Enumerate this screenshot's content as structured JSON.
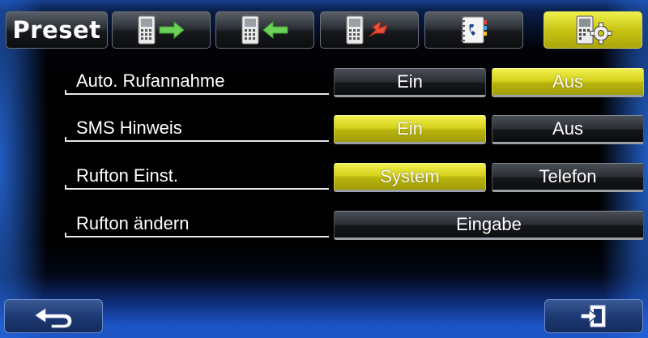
{
  "header": {
    "preset_label": "Preset",
    "tabs": [
      {
        "name": "tab-preset",
        "icon": "text",
        "active": false
      },
      {
        "name": "tab-outgoing-calls",
        "icon": "phone-arrow-out-icon",
        "active": false
      },
      {
        "name": "tab-incoming-calls",
        "icon": "phone-arrow-in-icon",
        "active": false
      },
      {
        "name": "tab-missed-calls",
        "icon": "phone-missed-icon",
        "active": false
      },
      {
        "name": "tab-phonebook",
        "icon": "phonebook-icon",
        "active": false
      },
      {
        "name": "tab-phone-settings",
        "icon": "phone-gear-icon",
        "active": true
      }
    ]
  },
  "settings": {
    "rows": [
      {
        "label": "Auto. Rufannahme",
        "options": [
          {
            "label": "Ein",
            "selected": false
          },
          {
            "label": "Aus",
            "selected": true
          }
        ]
      },
      {
        "label": "SMS Hinweis",
        "options": [
          {
            "label": "Ein",
            "selected": true
          },
          {
            "label": "Aus",
            "selected": false
          }
        ]
      },
      {
        "label": "Rufton Einst.",
        "options": [
          {
            "label": "System",
            "selected": true
          },
          {
            "label": "Telefon",
            "selected": false
          }
        ]
      },
      {
        "label": "Rufton ändern",
        "options": [
          {
            "label": "Eingabe",
            "selected": false
          }
        ]
      }
    ]
  },
  "footer": {
    "back_icon": "back-arrow-icon",
    "exit_icon": "exit-icon"
  },
  "colors": {
    "accent_yellow": "#d6d21c",
    "bg_blue": "#1d56c8",
    "button_dark": "#2a2d33"
  }
}
